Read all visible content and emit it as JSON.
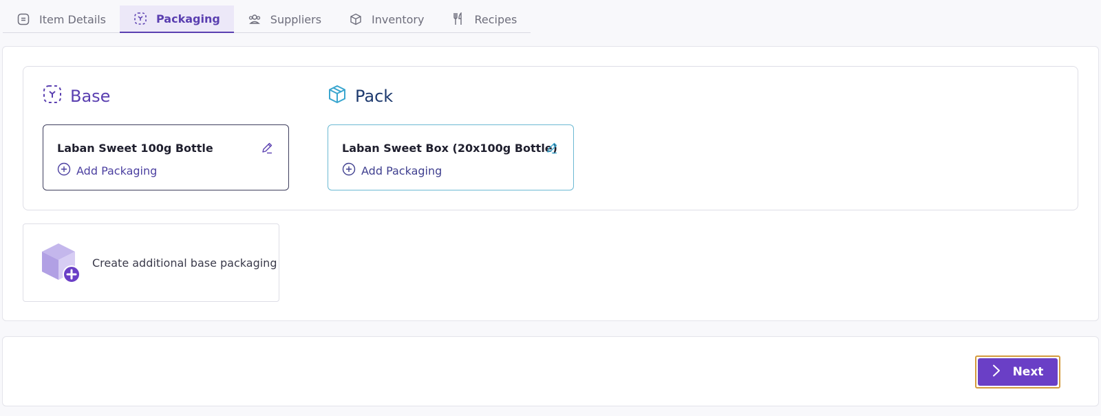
{
  "tabs": [
    {
      "label": "Item Details",
      "icon": "document-icon",
      "active": false
    },
    {
      "label": "Packaging",
      "icon": "packaging-icon",
      "active": true
    },
    {
      "label": "Suppliers",
      "icon": "users-icon",
      "active": false
    },
    {
      "label": "Inventory",
      "icon": "box-icon",
      "active": false
    },
    {
      "label": "Recipes",
      "icon": "utensils-icon",
      "active": false
    }
  ],
  "packaging": {
    "base": {
      "heading": "Base",
      "icon": "packaging-icon",
      "item_name": "Laban Sweet 100g Bottle",
      "add_label": "Add Packaging"
    },
    "pack": {
      "heading": "Pack",
      "icon": "box-icon",
      "item_name": "Laban Sweet Box (20x100g Bottle)",
      "add_label": "Add Packaging"
    },
    "create_label": "Create additional base packaging"
  },
  "footer": {
    "next_label": "Next"
  },
  "colors": {
    "accent": "#5a3fb0",
    "button": "#6a3fc6",
    "pack_heading": "#1e3a6e",
    "pack_border": "#6bb9d3",
    "focus_ring": "#d39a3c"
  }
}
